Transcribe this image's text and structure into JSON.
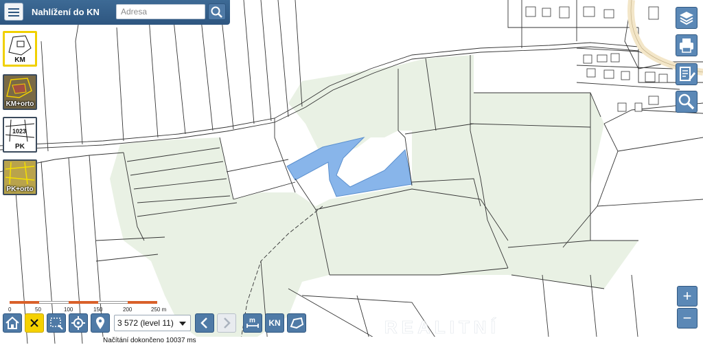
{
  "app": {
    "title": "Nahlížení do KN"
  },
  "search": {
    "placeholder": "Adresa"
  },
  "layers": [
    {
      "label": "KM",
      "active": true
    },
    {
      "label": "KM+orto",
      "active": false
    },
    {
      "label": "PK",
      "active": false
    },
    {
      "label": "PK+orto",
      "active": false
    }
  ],
  "right_toolbar": [
    "layers-icon",
    "printer-icon",
    "edit-document-icon",
    "magnifier-icon"
  ],
  "zoom": {
    "in_label": "+",
    "out_label": "−"
  },
  "scale_bar": {
    "labels": [
      "0",
      "50",
      "100",
      "150",
      "200",
      "250 m"
    ]
  },
  "bottom_toolbar": {
    "scale_value": "3 572 (level 11)",
    "buttons": [
      "home-icon",
      "close-icon",
      "zoom-rectangle-icon",
      "locate-icon",
      "marker-icon",
      "back-icon",
      "forward-icon",
      "measure-icon",
      "kn-button",
      "polygon-icon"
    ],
    "kn_label": "KN",
    "measure_label": "m"
  },
  "status": {
    "text": "Načítání dokončeno 10037 ms"
  },
  "watermark": "REALITNÍ"
}
